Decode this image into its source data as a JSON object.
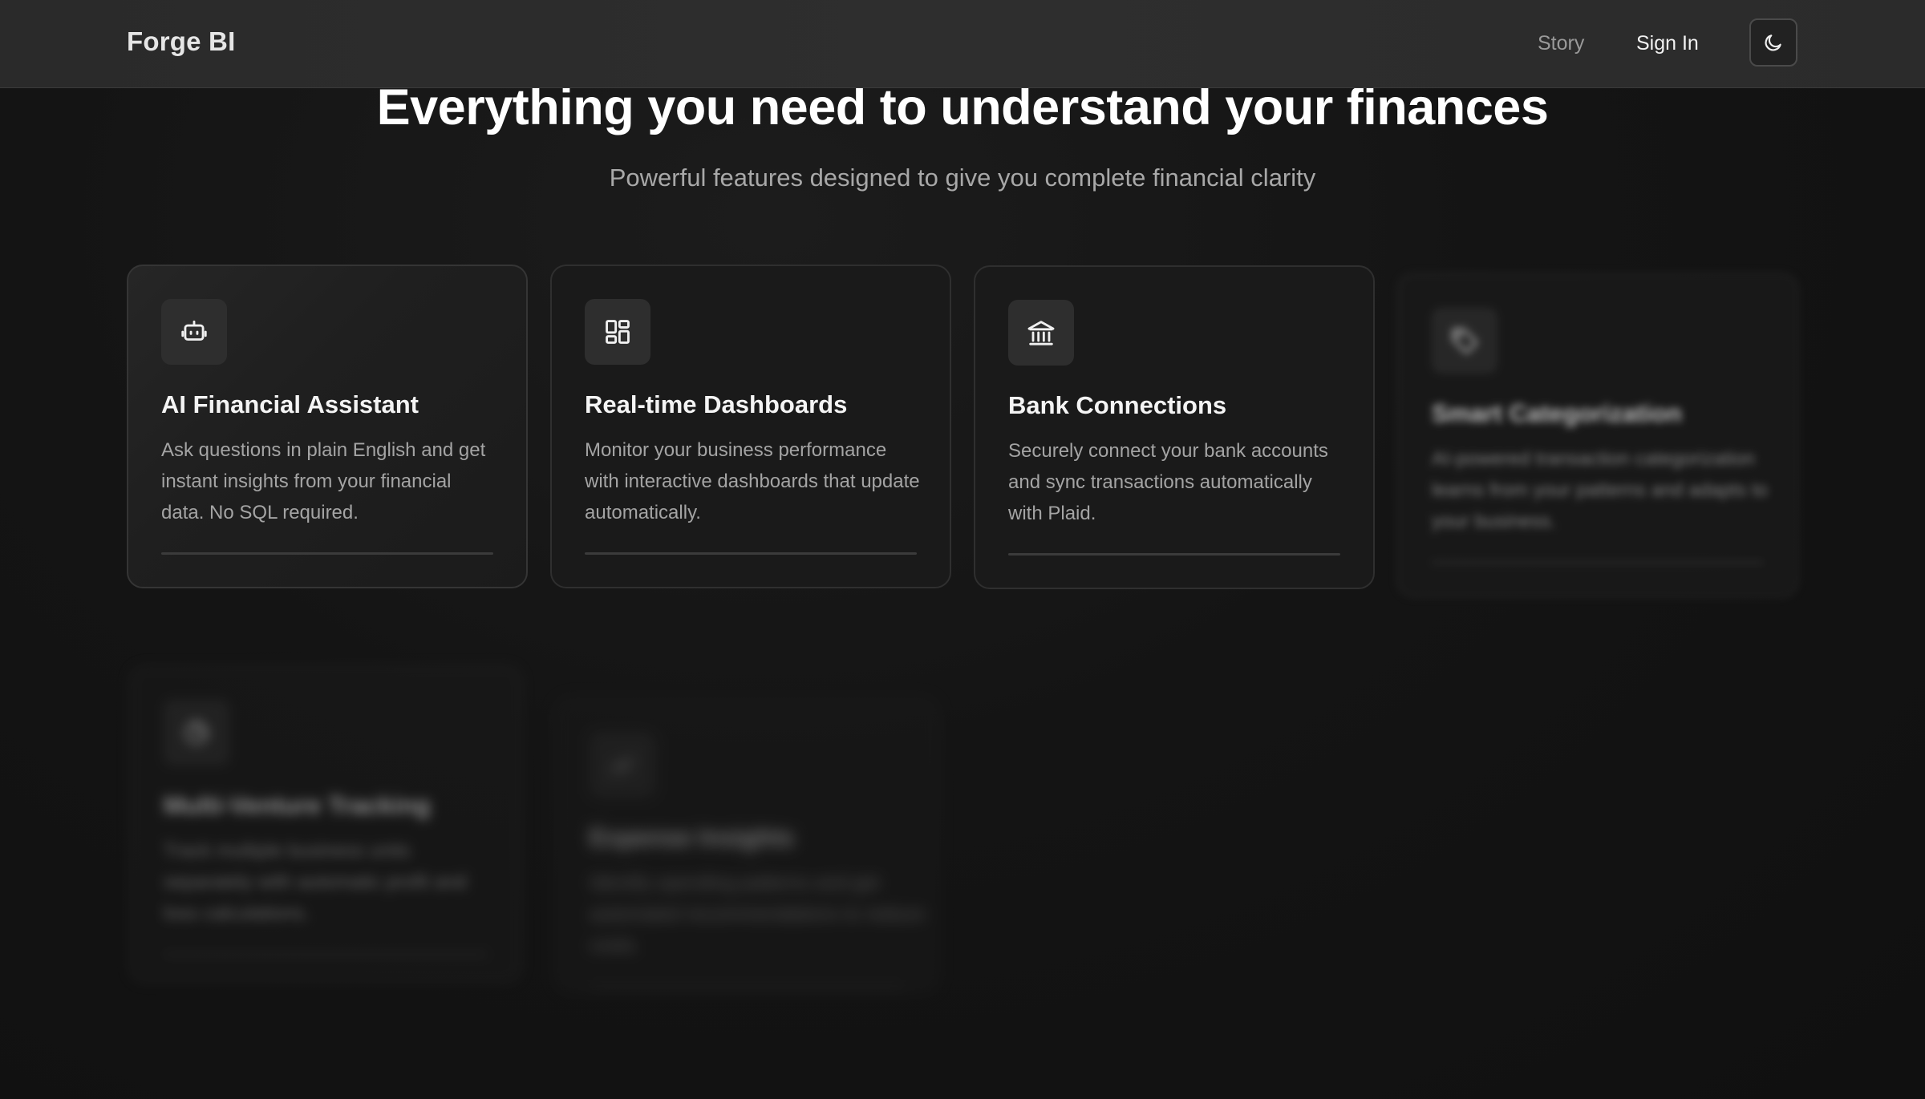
{
  "app": {
    "brand": "Forge BI"
  },
  "nav": {
    "story_label": "Story",
    "signin_label": "Sign In",
    "theme_toggle_icon": "moon-icon"
  },
  "hero": {
    "title": "Everything you need to understand your finances",
    "subtitle": "Powerful features designed to give you complete financial clarity"
  },
  "features": [
    {
      "icon": "robot-icon",
      "title": "AI Financial Assistant",
      "description": "Ask questions in plain English and get instant insights from your financial data. No SQL required."
    },
    {
      "icon": "dashboard-grid-icon",
      "title": "Real-time Dashboards",
      "description": "Monitor your business performance with interactive dashboards that update automatically."
    },
    {
      "icon": "bank-icon",
      "title": "Bank Connections",
      "description": "Securely connect your bank accounts and sync transactions automatically with Plaid."
    },
    {
      "icon": "tag-icon",
      "title": "Smart Categorization",
      "description": "AI-powered transaction categorization learns from your patterns and adapts to your business."
    },
    {
      "icon": "pie-icon",
      "title": "Multi-Venture Tracking",
      "description": "Track multiple business units separately with automatic profit and loss calculations."
    },
    {
      "icon": "insights-icon",
      "title": "Expense Insights",
      "description": "Identify spending patterns and get automated recommendations to reduce costs."
    }
  ]
}
